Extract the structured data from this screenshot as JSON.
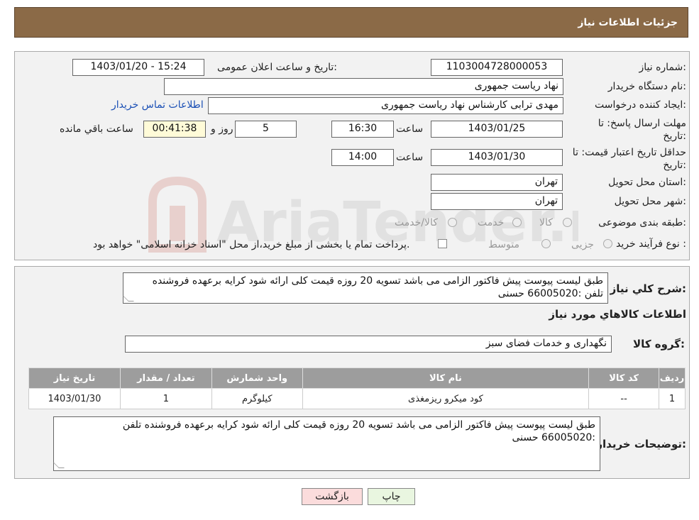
{
  "header": {
    "title": "جزئیات اطلاعات نیاز"
  },
  "fields": {
    "need_number_label": "شماره نیاز:",
    "need_number": "1103004728000053",
    "announce_label": "تاریخ و ساعت اعلان عمومی:",
    "announce_value": "1403/01/20 - 15:24",
    "buyer_org_label": "نام دستگاه خریدار:",
    "buyer_org": "نهاد ریاست جمهوری",
    "requester_label": "ایجاد کننده درخواست:",
    "requester": "مهدی  ترابی کارشناس نهاد ریاست جمهوری",
    "contact_link": "اطلاعات تماس خریدار",
    "deadline_label_1": "مهلت ارسال پاسخ: تا",
    "deadline_label_2": "تاریخ:",
    "deadline_date": "1403/01/25",
    "time_label": "ساعت",
    "deadline_time": "16:30",
    "days_value": "5",
    "days_label": "روز و",
    "remaining_time": "00:41:38",
    "remaining_label": "ساعت باقي مانده",
    "validity_label_1": "حداقل تاریخ اعتبار قیمت: تا",
    "validity_label_2": "تاریخ:",
    "validity_date": "1403/01/30",
    "validity_time_label": "ساعت",
    "validity_time": "14:00",
    "province_label": "استان محل تحویل:",
    "province": "تهران",
    "city_label": "شهر محل تحویل:",
    "city": "تهران",
    "category_label": "طبقه بندی موضوعی:",
    "category_options": [
      "کالا",
      "خدمت",
      "کالا/خدمت"
    ],
    "process_label": "نوع فرآیند خرید :",
    "process_options": [
      "جزیی",
      "متوسط"
    ],
    "process_note": "پرداخت تمام یا بخشی از مبلغ خرید،از محل \"اسناد خزانه اسلامی\" خواهد بود."
  },
  "description": {
    "label": "شرح کلي نياز:",
    "line1": "طبق لیست پیوست پیش فاکتور الزامی می باشد تسویه 20 روزه قیمت کلی ارائه شود کرایه برعهده فروشنده",
    "line2": "تلفن :66005020 حسنی"
  },
  "goods": {
    "title": "اطلاعات کالاهاي مورد نياز",
    "group_label": "گروه کالا:",
    "group_value": "نگهداری و خدمات فضای سبز",
    "columns": [
      "رديف",
      "کد کالا",
      "نام کالا",
      "واحد شمارش",
      "تعداد / مقدار",
      "تاریخ نیاز"
    ],
    "rows": [
      [
        "1",
        "--",
        "کود میکرو ریزمغذی",
        "کیلوگرم",
        "1",
        "1403/01/30"
      ]
    ]
  },
  "buyer_notes": {
    "label": "توضیحات خریدار:",
    "line1": "طبق لیست پیوست پیش فاکتور الزامی می باشد تسویه 20 روزه قیمت کلی ارائه شود کرایه برعهده فروشنده تلفن",
    "line2": ":66005020 حسنی"
  },
  "buttons": {
    "print": "چاپ",
    "back": "بازگشت"
  },
  "watermark": {
    "text": "AriaTender.neT"
  },
  "colors": {
    "header_bg": "#8b6a47",
    "table_header_bg": "#9d9d9d",
    "back_button_bg": "#fbdcdc",
    "print_button_bg": "#e9f6e0",
    "timer_bg": "#fffbd8"
  }
}
